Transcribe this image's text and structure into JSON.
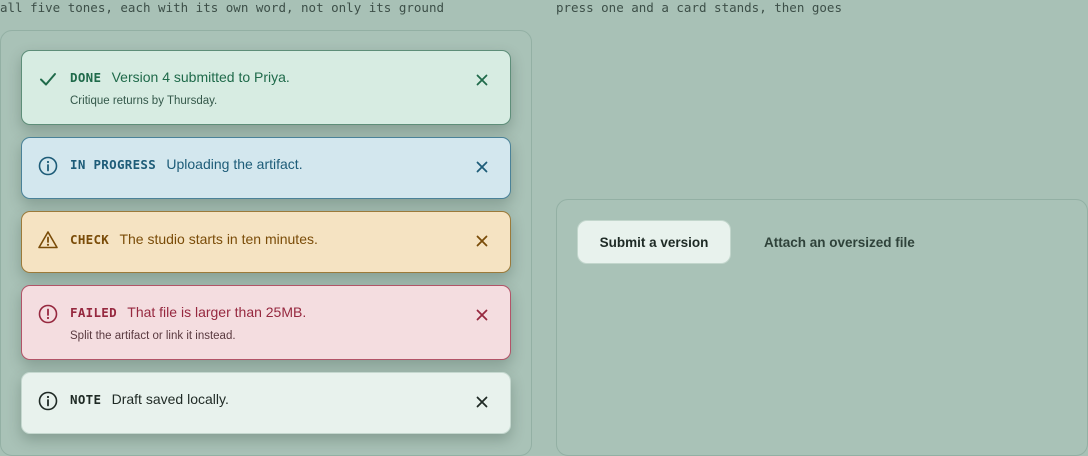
{
  "captions": {
    "left": "all five tones, each with its own word, not only its ground",
    "right": "press one and a card stands, then goes"
  },
  "toasts": [
    {
      "tag": "DONE",
      "message": "Version 4 submitted to Priya.",
      "detail": "Critique returns by Thursday.",
      "icon": "check-icon"
    },
    {
      "tag": "IN PROGRESS",
      "message": "Uploading the artifact.",
      "icon": "info-icon"
    },
    {
      "tag": "CHECK",
      "message": "The studio starts in ten minutes.",
      "icon": "warning-triangle-icon"
    },
    {
      "tag": "FAILED",
      "message": "That file is larger than 25MB.",
      "detail": "Split the artifact or link it instead.",
      "icon": "error-circle-icon"
    },
    {
      "tag": "NOTE",
      "message": "Draft saved locally.",
      "icon": "info-icon"
    }
  ],
  "actions": {
    "submit": "Submit a version",
    "attach": "Attach an oversized file"
  },
  "colors": {
    "background": "#a8c1b6",
    "done": "#1f6a4a",
    "progress": "#1d5c78",
    "check": "#7a4c08",
    "failed": "#96283f",
    "note": "#1f2a25"
  }
}
